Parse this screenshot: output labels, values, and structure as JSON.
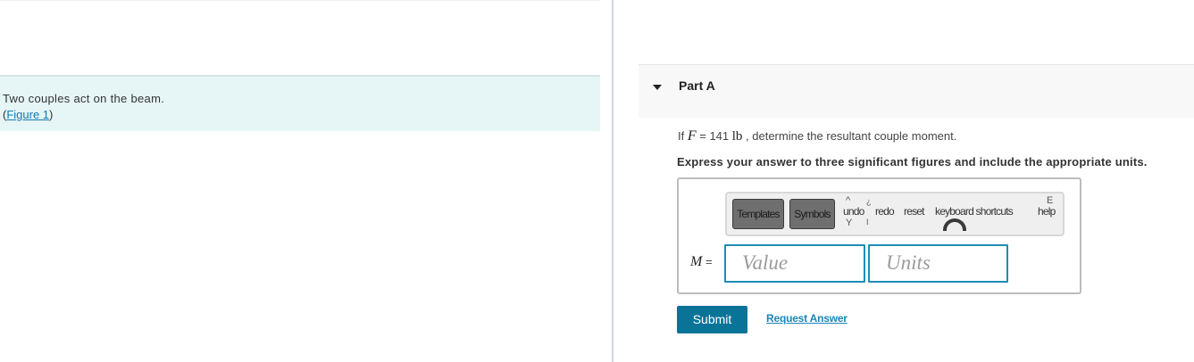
{
  "problem": {
    "text": "Two couples act on the beam.",
    "figure_open": "(",
    "figure_link": "Figure 1",
    "figure_close": ")"
  },
  "part": {
    "title": "Part A"
  },
  "question": {
    "prefix": "If ",
    "variable": "F",
    "equals": " = 141 ",
    "unit": "lb",
    "suffix": " , determine the resultant couple moment."
  },
  "instruction": "Express your answer to three significant figures and include the appropriate units.",
  "toolbar": {
    "templates_label": "Templates",
    "symbols_label": "Symbols",
    "undo_label": "undo",
    "redo_label": "redo",
    "reset_label": "reset",
    "keyboard_label": "keyboard shortcuts",
    "help_label": "help"
  },
  "answer": {
    "variable": "M",
    "equals": "=",
    "value_placeholder": "Value",
    "units_placeholder": "Units"
  },
  "buttons": {
    "submit": "Submit",
    "request_answer": "Request Answer"
  },
  "colors": {
    "accent": "#0a7398",
    "link": "#1a86b8",
    "problem_bg": "#e6f5f6"
  }
}
